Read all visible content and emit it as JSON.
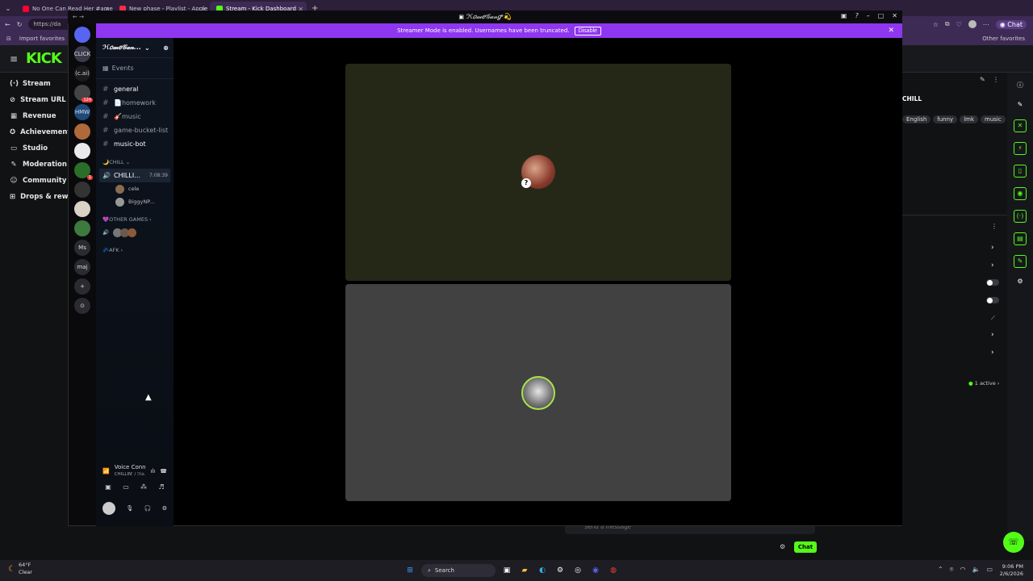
{
  "browser": {
    "tabs": [
      {
        "label": "No One Can Read Her #americanat",
        "color": "#ff0033"
      },
      {
        "label": "New phase - Playlist - Apple Music",
        "color": "#fa2d48"
      },
      {
        "label": "Stream - Kick Dashboard",
        "color": "#53fc18"
      }
    ],
    "new_tab": "+",
    "url": "https://da",
    "favorites_import": "Import favorites",
    "other_favorites": "Other favorites",
    "copilot_label": "Chat"
  },
  "kick": {
    "logo": "KICK",
    "nav": [
      {
        "icon": "(·)",
        "label": "Stream"
      },
      {
        "icon": "⊘",
        "label": "Stream URL & Key"
      },
      {
        "icon": "▦",
        "label": "Revenue"
      },
      {
        "icon": "✪",
        "label": "Achievements"
      },
      {
        "icon": "▭",
        "label": "Studio"
      },
      {
        "icon": "✎",
        "label": "Moderation"
      },
      {
        "icon": "☺",
        "label": "Community"
      },
      {
        "icon": "⊞",
        "label": "Drops & rewards"
      }
    ],
    "stream_title": "CHILL",
    "tags": [
      "English",
      "funny",
      "lmk",
      "music"
    ],
    "active_count": "1 active",
    "chat_placeholder": "Send a message",
    "chat_button": "Chat"
  },
  "discord": {
    "window_title": "ℋ𝑜𝓂𝑒𝒢𝒶𝓃𝑔ᵃ💫",
    "banner_text": "Streamer Mode is enabled. Usernames have been truncated.",
    "banner_button": "Disable",
    "servers": [
      {
        "label": "",
        "color": "#5865f2"
      },
      {
        "label": "CLICK",
        "color": "#3a3a4a"
      },
      {
        "label": "(c.ai)",
        "color": "#1b1b1b"
      },
      {
        "label": "",
        "color": "#444",
        "badge": "124"
      },
      {
        "label": "HMW",
        "color": "#1e4a7a"
      },
      {
        "label": "",
        "color": "#b0693a"
      },
      {
        "label": "",
        "color": "#e9e9e9"
      },
      {
        "label": "",
        "color": "#2a6e2a",
        "badge": "1"
      },
      {
        "label": "",
        "color": "#333"
      },
      {
        "label": "",
        "color": "#d9d2c5"
      },
      {
        "label": "",
        "color": "#3d7a3d"
      },
      {
        "label": "Ms",
        "color": "#2a2b30"
      },
      {
        "label": "maj",
        "color": "#2a2b30"
      },
      {
        "label": "+",
        "color": "#2a2b30"
      },
      {
        "label": "⊙",
        "color": "#2a2b30"
      }
    ],
    "server_name": "ℋ𝑜𝓂𝑒𝒢𝒶𝓃...",
    "events_label": "Events",
    "text_channels": [
      {
        "name": "general",
        "bright": true
      },
      {
        "name": "📄homework",
        "bright": false
      },
      {
        "name": "🎸music",
        "bright": false
      },
      {
        "name": "game-bucket-list",
        "bright": false
      },
      {
        "name": "music-bot",
        "bright": true
      }
    ],
    "category_chill": "🌙CHILL",
    "voice_channel": "CHILLI...",
    "voice_timer": "7:08:39",
    "voice_users": [
      {
        "name": "cele"
      },
      {
        "name": "BiggyNP..."
      }
    ],
    "category_other_games": "💜OTHER GAMES",
    "category_afk": "💤AFK",
    "voice_connected": "Voice Connected",
    "voice_connected_sub": "CHILLIN' / ℋ𝑜...",
    "stage_tiles": [
      {
        "id": "tile-1",
        "bg": "#262817"
      },
      {
        "id": "tile-2",
        "bg": "#414141"
      }
    ]
  },
  "taskbar": {
    "weather_temp": "64°F",
    "weather_desc": "Clear",
    "search_label": "Search",
    "time": "9:06 PM",
    "date": "2/6/2026"
  }
}
